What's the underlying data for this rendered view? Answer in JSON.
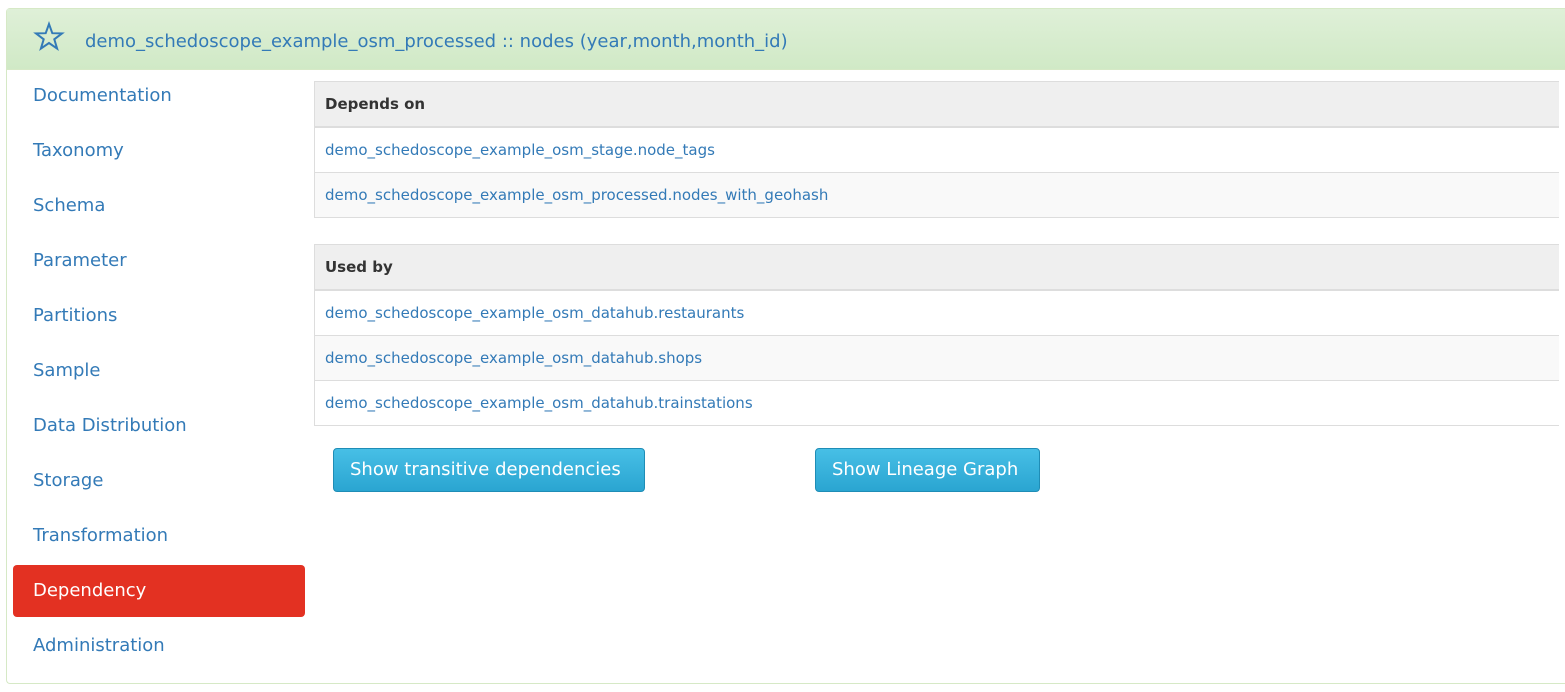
{
  "header": {
    "title": "demo_schedoscope_example_osm_processed :: nodes (year,month,month_id)",
    "icon": "star-outline-icon"
  },
  "sidebar": {
    "items": [
      {
        "label": "Documentation",
        "active": false
      },
      {
        "label": "Taxonomy",
        "active": false
      },
      {
        "label": "Schema",
        "active": false
      },
      {
        "label": "Parameter",
        "active": false
      },
      {
        "label": "Partitions",
        "active": false
      },
      {
        "label": "Sample",
        "active": false
      },
      {
        "label": "Data Distribution",
        "active": false
      },
      {
        "label": "Storage",
        "active": false
      },
      {
        "label": "Transformation",
        "active": false
      },
      {
        "label": "Dependency",
        "active": true
      },
      {
        "label": "Administration",
        "active": false
      }
    ]
  },
  "depends_on": {
    "header": "Depends on",
    "rows": [
      "demo_schedoscope_example_osm_stage.node_tags",
      "demo_schedoscope_example_osm_processed.nodes_with_geohash"
    ]
  },
  "used_by": {
    "header": "Used by",
    "rows": [
      "demo_schedoscope_example_osm_datahub.restaurants",
      "demo_schedoscope_example_osm_datahub.shops",
      "demo_schedoscope_example_osm_datahub.trainstations"
    ]
  },
  "actions": {
    "transitive_label": "Show transitive dependencies",
    "lineage_label": "Show Lineage Graph"
  },
  "colors": {
    "accent": "#337ab7",
    "active_nav": "#e33122",
    "heading_bg": "#dff0d8",
    "button": "#31b0d5"
  }
}
